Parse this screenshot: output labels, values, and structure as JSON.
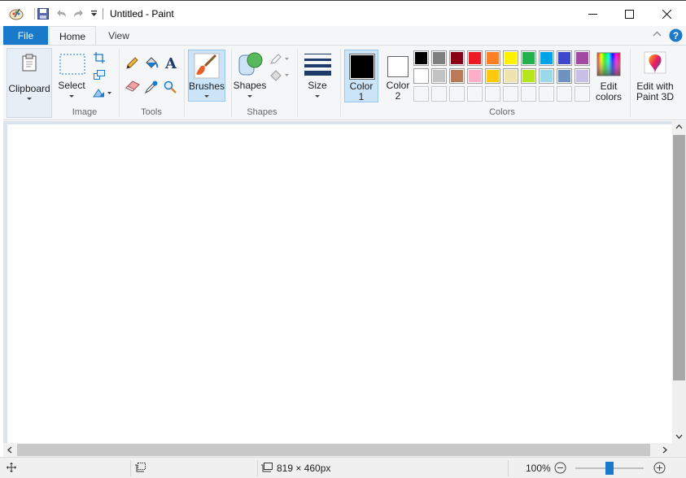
{
  "window": {
    "title": "Untitled - Paint"
  },
  "tabs": [
    {
      "label": "File"
    },
    {
      "label": "Home"
    },
    {
      "label": "View"
    }
  ],
  "ribbon": {
    "clipboard": {
      "label": "Clipboard"
    },
    "image": {
      "select_label": "Select",
      "group_label": "Image"
    },
    "tools": {
      "group_label": "Tools"
    },
    "brushes": {
      "label": "Brushes"
    },
    "shapes": {
      "label": "Shapes",
      "group_label": "Shapes"
    },
    "size": {
      "label": "Size"
    },
    "color1": {
      "label_line1": "Color",
      "label_line2": "1",
      "value": "#000000"
    },
    "color2": {
      "label_line1": "Color",
      "label_line2": "2",
      "value": "#ffffff"
    },
    "colors": {
      "group_label": "Colors",
      "row1": [
        "#000000",
        "#7f7f7f",
        "#880015",
        "#ed1c24",
        "#ff7f27",
        "#fff200",
        "#22b14c",
        "#00a2e8",
        "#3f48cc",
        "#a349a4"
      ],
      "row2": [
        "#ffffff",
        "#c3c3c3",
        "#b97a57",
        "#ffaec9",
        "#ffc90e",
        "#efe4b0",
        "#b5e61d",
        "#99d9ea",
        "#7092be",
        "#c8bfe7"
      ],
      "row3": [
        "#f5f6f7",
        "#f5f6f7",
        "#f5f6f7",
        "#f5f6f7",
        "#f5f6f7",
        "#f5f6f7",
        "#f5f6f7",
        "#f5f6f7",
        "#f5f6f7",
        "#f5f6f7"
      ]
    },
    "edit_colors": {
      "line1": "Edit",
      "line2": "colors"
    },
    "paint3d": {
      "line1": "Edit with",
      "line2": "Paint 3D"
    }
  },
  "statusbar": {
    "canvas_size": "819 × 460px",
    "zoom": "100%",
    "zoom_level": 0.5
  },
  "accent": "#1979ca"
}
